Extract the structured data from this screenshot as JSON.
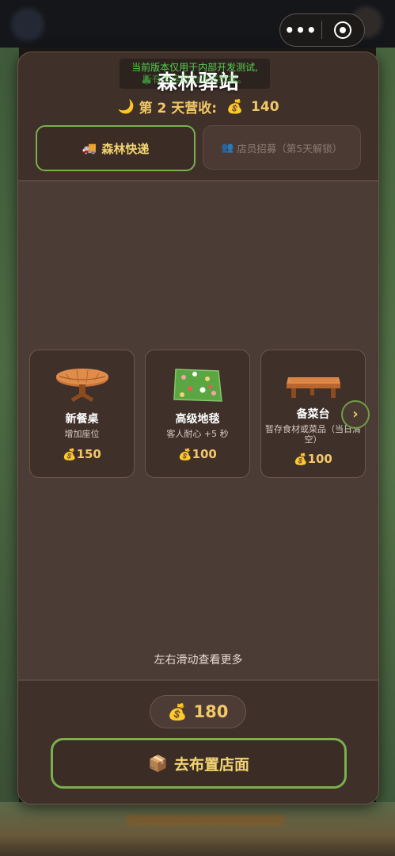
{
  "notice": {
    "line1": "当前版本仅用于内部开发测试,",
    "line2": "所有内容均为测试数据。"
  },
  "header": {
    "title": "森林驿站",
    "revenue": {
      "icon": "moon-icon",
      "label": "第 2 天营收:",
      "value": "140"
    }
  },
  "tabs": [
    {
      "label": "森林快递",
      "icon": "truck-icon",
      "active": true
    },
    {
      "label": "店员招募（第5天解锁）",
      "icon": "people-icon",
      "locked": true
    }
  ],
  "items": [
    {
      "name": "新餐桌",
      "desc": "增加座位",
      "price": "150",
      "image": "round-table-icon"
    },
    {
      "name": "高级地毯",
      "desc": "客人耐心 +5 秒",
      "price": "100",
      "image": "flower-rug-icon"
    },
    {
      "name": "备菜台",
      "desc": "暂存食材或菜品（当日清空）",
      "price": "100",
      "image": "wood-bench-icon"
    }
  ],
  "scroll_hint": "左右滑动查看更多",
  "balance": "180",
  "cta_label": "去布置店面",
  "colors": {
    "accent_green": "#78b04e",
    "gold": "#f3c866",
    "panel": "#3f302a"
  }
}
